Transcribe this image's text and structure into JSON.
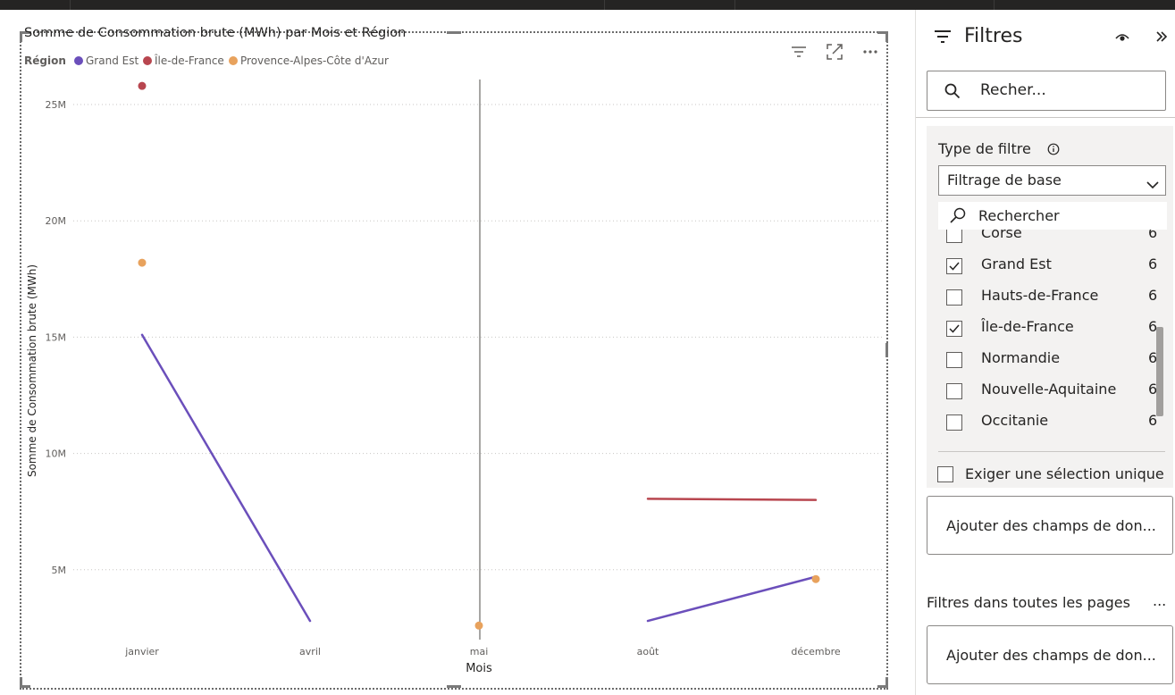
{
  "visual": {
    "title": "Somme de Consommation brute (MWh) par Mois et Région",
    "legend_title": "Région",
    "icons": [
      "filter-icon",
      "focus-mode-icon",
      "more-options-icon"
    ]
  },
  "chart_data": {
    "type": "line",
    "title": "Somme de Consommation brute (MWh) par Mois et Région",
    "xlabel": "Mois",
    "ylabel": "Somme de Consommation brute (MWh)",
    "categories": [
      "janvier",
      "avril",
      "mai",
      "août",
      "décembre"
    ],
    "y_ticks": [
      "5M",
      "10M",
      "15M",
      "20M",
      "25M"
    ],
    "y_tick_values": [
      5000000,
      10000000,
      15000000,
      20000000,
      25000000
    ],
    "ylim": [
      0,
      26500000
    ],
    "grid": true,
    "legend_position": "top-left",
    "series": [
      {
        "name": "Grand Est",
        "color": "#6b4fbb",
        "values": [
          15100000,
          2800000,
          null,
          2800000,
          4700000
        ]
      },
      {
        "name": "Île-de-France",
        "color": "#b8464f",
        "values": [
          25800000,
          null,
          null,
          8050000,
          8000000
        ]
      },
      {
        "name": "Provence-Alpes-Côte d'Azur",
        "color": "#e8a25d",
        "values": [
          18200000,
          null,
          2600000,
          null,
          4600000
        ]
      }
    ]
  },
  "filter_pane": {
    "title": "Filtres",
    "search_placeholder": "Recher...",
    "filter_type_label": "Type de filtre",
    "filter_type_value": "Filtrage de base",
    "list_search_placeholder": "Rechercher",
    "items": [
      {
        "label": "Corse",
        "count": "6",
        "checked": false
      },
      {
        "label": "Grand Est",
        "count": "6",
        "checked": true
      },
      {
        "label": "Hauts-de-France",
        "count": "6",
        "checked": false
      },
      {
        "label": "Île-de-France",
        "count": "6",
        "checked": true
      },
      {
        "label": "Normandie",
        "count": "6",
        "checked": false
      },
      {
        "label": "Nouvelle-Aquitaine",
        "count": "6",
        "checked": false
      },
      {
        "label": "Occitanie",
        "count": "6",
        "checked": false
      }
    ],
    "require_single_label": "Exiger une sélection unique",
    "add_fields_label": "Ajouter des champs de don...",
    "all_pages_label": "Filtres dans toutes les pages",
    "more_label": "...",
    "add_fields_label_2": "Ajouter des champs de don..."
  }
}
